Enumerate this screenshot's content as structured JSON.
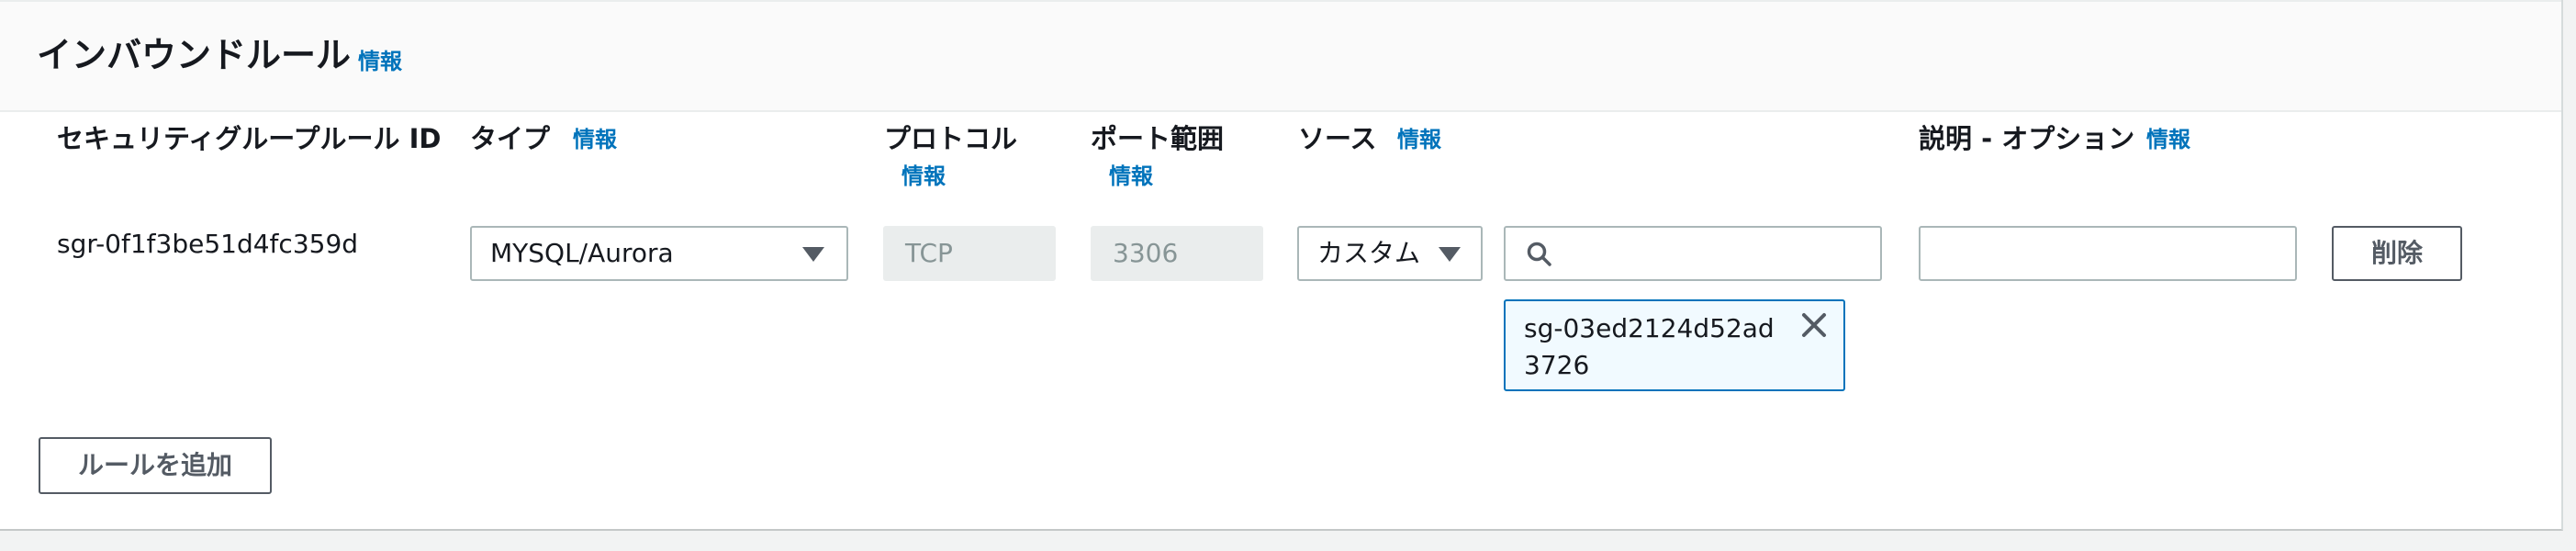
{
  "section": {
    "title": "インバウンドルール",
    "info_label": "情報"
  },
  "columns": {
    "rule_id": "セキュリティグループルール ID",
    "type": "タイプ",
    "protocol": "プロトコル",
    "port_range": "ポート範囲",
    "source": "ソース",
    "description": "説明 - オプション",
    "info_label": "情報"
  },
  "rule": {
    "id": "sgr-0f1f3be51d4fc359d",
    "type_value": "MYSQL/Aurora",
    "protocol_value": "TCP",
    "port_value": "3306",
    "source_type_value": "カスタム",
    "source_search_value": "",
    "source_token": "sg-03ed2124d52ad3726",
    "description_value": "",
    "delete_label": "削除"
  },
  "actions": {
    "add_rule_label": "ルールを追加"
  },
  "colors": {
    "link": "#0073bb",
    "token_border": "#0073bb",
    "token_bg": "#f1faff",
    "disabled_bg": "#eaeded"
  },
  "icons": {
    "dropdown": "caret-down-icon",
    "search": "search-icon",
    "remove": "close-icon"
  }
}
